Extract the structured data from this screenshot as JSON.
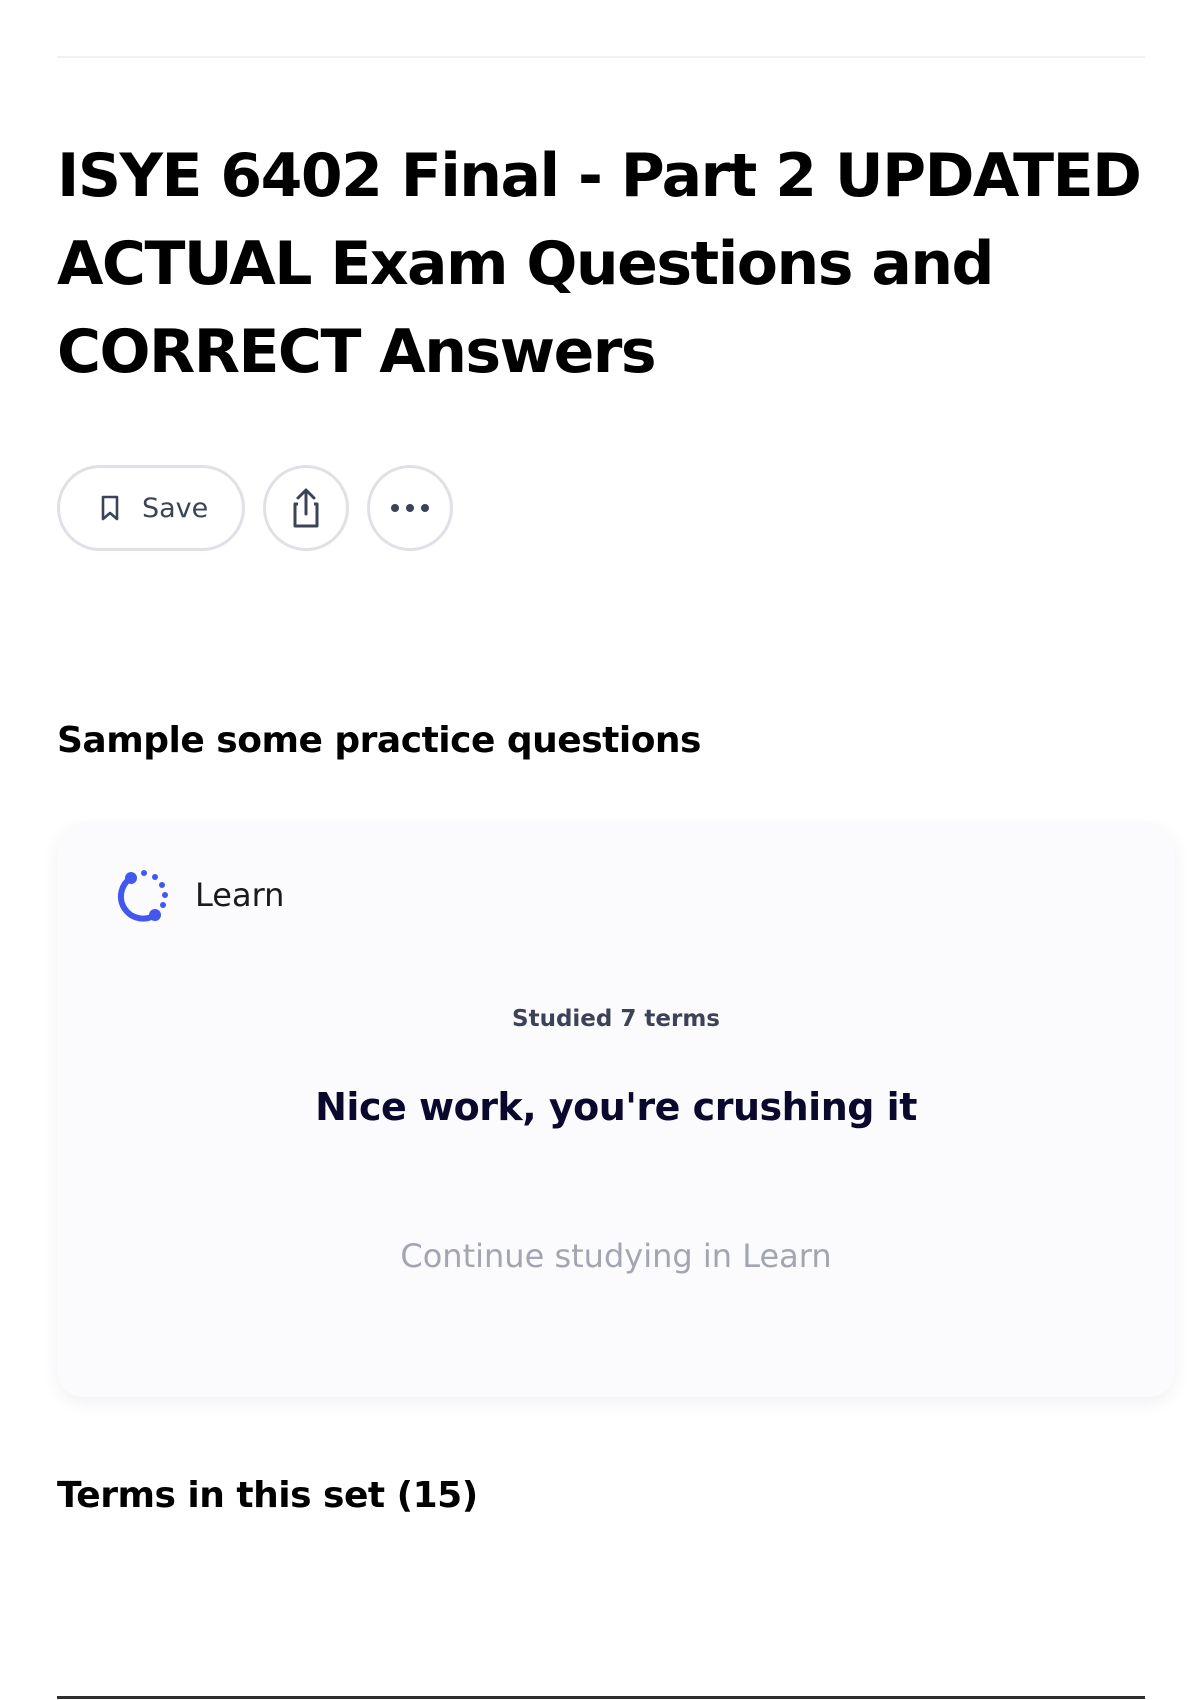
{
  "header": {
    "title": "ISYE 6402 Final - Part 2 UPDATED ACTUAL Exam Questions and CORRECT Answers"
  },
  "actions": {
    "save_label": "Save",
    "icons": [
      "bookmark-icon",
      "share-icon",
      "more-icon"
    ]
  },
  "practice": {
    "heading": "Sample some practice questions",
    "card": {
      "mode_label": "Learn",
      "mode_icon": "learn-icon",
      "studied": "Studied 7 terms",
      "message": "Nice work, you're crushing it",
      "continue_label": "Continue studying in Learn"
    }
  },
  "terms": {
    "heading": "Terms in this set (15)"
  },
  "colors": {
    "accent": "#4257f0",
    "text_dark": "#0a092d",
    "text_muted": "#3c4258",
    "link_muted": "#a3a6b2",
    "border": "#dfe1e6"
  }
}
